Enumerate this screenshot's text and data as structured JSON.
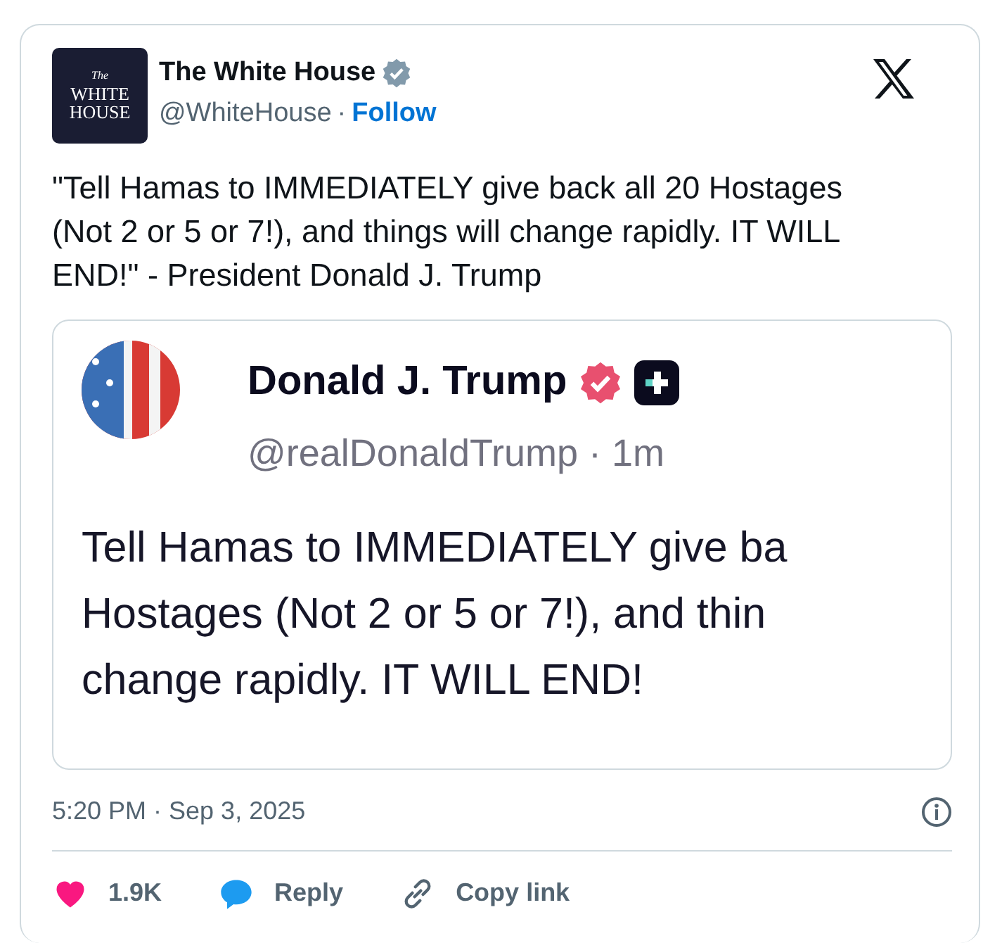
{
  "author": {
    "logo_lines": [
      "The",
      "WHITE",
      "HOUSE"
    ],
    "name": "The White House",
    "handle": "@WhiteHouse",
    "separator": "·",
    "follow": "Follow",
    "verified": true
  },
  "text": "\"Tell Hamas to IMMEDIATELY give back all 20 Hostages (Not 2 or 5 or 7!), and things will change rapidly. IT WILL END!\" - President Donald J. Trump",
  "quote": {
    "name": "Donald J. Trump",
    "verified": true,
    "handle": "@realDonaldTrump · 1m",
    "lines": [
      "Tell Hamas to IMMEDIATELY give ba",
      "Hostages (Not 2 or 5 or 7!), and thin",
      "change rapidly. IT WILL END!"
    ]
  },
  "timestamp": "5:20 PM · Sep 3, 2025",
  "actions": [
    {
      "kind": "like",
      "label": "1.9K"
    },
    {
      "kind": "reply",
      "label": "Reply"
    },
    {
      "kind": "copy",
      "label": "Copy link"
    }
  ]
}
